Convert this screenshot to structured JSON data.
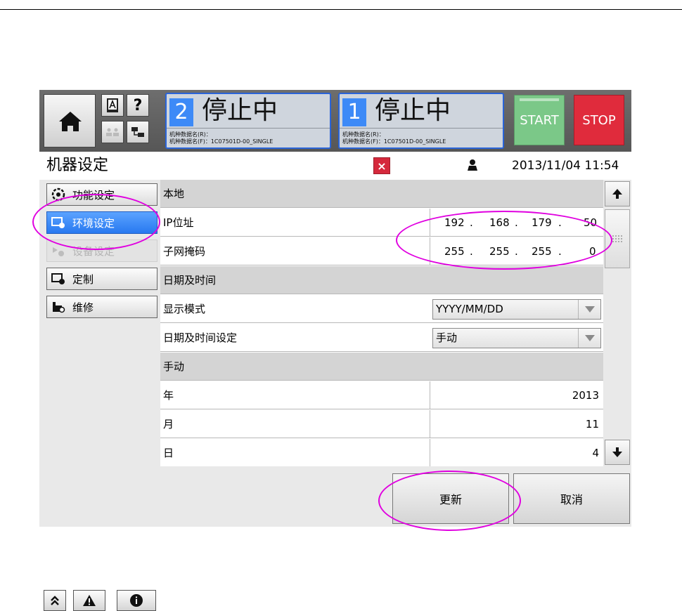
{
  "header": {
    "home_icon": "home-icon",
    "manual_icon": "book-a-icon",
    "help_label": "?",
    "status_panels": [
      {
        "number": "2",
        "status": "停止中",
        "line1": "机种数据名(R)：",
        "line2": "机种数据名(F)：1C07501D-00_SINGLE"
      },
      {
        "number": "1",
        "status": "停止中",
        "line1": "机种数据名(R)：",
        "line2": "机种数据名(F)：1C07501D-00_SINGLE"
      }
    ],
    "start_label": "START",
    "stop_label": "STOP",
    "start_color": "#7bc888",
    "stop_color": "#e02b3c"
  },
  "titlebar": {
    "title": "机器设定",
    "close_label": "×",
    "datetime": "2013/11/04 11:54"
  },
  "sidebar": {
    "items": [
      {
        "label": "功能设定",
        "icon": "function-icon",
        "state": "normal"
      },
      {
        "label": "环境设定",
        "icon": "environment-icon",
        "state": "active"
      },
      {
        "label": "设备设定",
        "icon": "device-icon",
        "state": "disabled"
      },
      {
        "label": "定制",
        "icon": "customize-icon",
        "state": "normal"
      },
      {
        "label": "维修",
        "icon": "maintenance-icon",
        "state": "normal"
      }
    ],
    "bottom_icons": [
      "double-chevron-up-icon",
      "warning-icon",
      "info-icon"
    ]
  },
  "table": {
    "section_local": "本地",
    "ip_label": "IP位址",
    "ip_octets": [
      "192",
      "168",
      "179",
      "50"
    ],
    "subnet_label": "子网掩码",
    "subnet_octets": [
      "255",
      "255",
      "255",
      "0"
    ],
    "section_datetime": "日期及时间",
    "display_mode_label": "显示模式",
    "display_mode_value": "YYYY/MM/DD",
    "datetime_setting_label": "日期及时间设定",
    "datetime_setting_value": "手动",
    "section_manual": "手动",
    "year_label": "年",
    "year_value": "2013",
    "month_label": "月",
    "month_value": "11",
    "day_label": "日",
    "day_value": "4",
    "dot": "."
  },
  "actions": {
    "update_label": "更新",
    "cancel_label": "取消"
  },
  "colors": {
    "accent": "#2879f0",
    "highlight_ellipse": "#e000e0"
  }
}
